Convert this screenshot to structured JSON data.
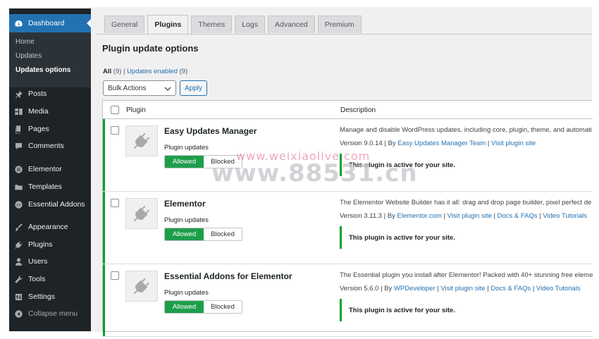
{
  "sidebar": {
    "dashboard": "Dashboard",
    "submenu": [
      "Home",
      "Updates",
      "Updates options"
    ],
    "items": [
      {
        "label": "Posts",
        "icon": "pin-icon"
      },
      {
        "label": "Media",
        "icon": "media-icon"
      },
      {
        "label": "Pages",
        "icon": "pages-icon"
      },
      {
        "label": "Comments",
        "icon": "comments-icon"
      },
      {
        "label": "Elementor",
        "icon": "elementor-icon"
      },
      {
        "label": "Templates",
        "icon": "folder-icon"
      },
      {
        "label": "Essential Addons",
        "icon": "essential-addons-icon"
      },
      {
        "label": "Appearance",
        "icon": "brush-icon"
      },
      {
        "label": "Plugins",
        "icon": "plugin-icon"
      },
      {
        "label": "Users",
        "icon": "users-icon"
      },
      {
        "label": "Tools",
        "icon": "wrench-icon"
      },
      {
        "label": "Settings",
        "icon": "settings-icon"
      },
      {
        "label": "Collapse menu",
        "icon": "collapse-icon"
      }
    ]
  },
  "tabs": [
    "General",
    "Plugins",
    "Themes",
    "Logs",
    "Advanced",
    "Premium"
  ],
  "active_tab": "Plugins",
  "page_title": "Plugin update options",
  "filters": {
    "all_label": "All",
    "all_count": "(9)",
    "separator": "|",
    "enabled_label": "Updates enabled",
    "enabled_count": "(9)"
  },
  "bulk": {
    "select_value": "Bulk Actions",
    "apply_label": "Apply"
  },
  "table": {
    "col_plugin": "Plugin",
    "col_description": "Description",
    "plugin_updates_label": "Plugin updates",
    "allowed_label": "Allowed",
    "blocked_label": "Blocked",
    "active_notice": "This plugin is active for your site.",
    "rows": [
      {
        "name": "Easy Updates Manager",
        "description": "Manage and disable WordPress updates, including core, plugin, theme, and automati",
        "version": "Version 9.0.14",
        "by": "By",
        "author": "Easy Updates Manager Team",
        "links": [
          "Visit plugin site"
        ]
      },
      {
        "name": "Elementor",
        "description": "The Elementor Website Builder has it all: drag and drop page builder, pixel perfect de",
        "version": "Version 3.11.3",
        "by": "By",
        "author": "Elementor.com",
        "links": [
          "Visit plugin site",
          "Docs & FAQs",
          "Video Tutorials"
        ]
      },
      {
        "name": "Essential Addons for Elementor",
        "description": "The Essential plugin you install after Elementor! Packed with 40+ stunning free elemer",
        "version": "Version 5.6.0",
        "by": "By",
        "author": "WPDeveloper",
        "links": [
          "Visit plugin site",
          "Docs & FAQs",
          "Video Tutorials"
        ]
      }
    ]
  },
  "watermark": {
    "small": "www.weixiaolive.com",
    "big": "www.88531.cn"
  },
  "colors": {
    "sidebar": "#1d2327",
    "accent": "#2271b1",
    "active_green": "#00a32a",
    "toggle_green": "#1e9e4b"
  }
}
